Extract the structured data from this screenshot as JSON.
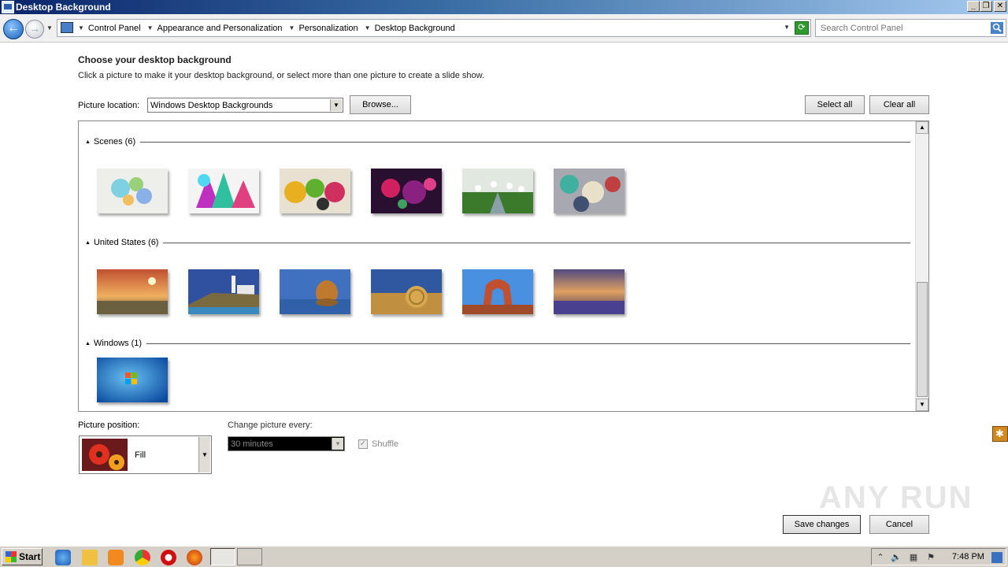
{
  "window": {
    "title": "Desktop Background"
  },
  "breadcrumbs": [
    "Control Panel",
    "Appearance and Personalization",
    "Personalization",
    "Desktop Background"
  ],
  "search": {
    "placeholder": "Search Control Panel"
  },
  "main": {
    "heading": "Choose your desktop background",
    "description": "Click a picture to make it your desktop background, or select more than one picture to create a slide show.",
    "location_label": "Picture location:",
    "location_value": "Windows Desktop Backgrounds",
    "browse_label": "Browse...",
    "select_all_label": "Select all",
    "clear_all_label": "Clear all"
  },
  "groups": [
    {
      "label": "Scenes (6)",
      "count": 6
    },
    {
      "label": "United States (6)",
      "count": 6
    },
    {
      "label": "Windows (1)",
      "count": 1
    }
  ],
  "bottom": {
    "position_label": "Picture position:",
    "position_value": "Fill",
    "interval_label": "Change picture every:",
    "interval_value": "30 minutes",
    "shuffle_label": "Shuffle",
    "shuffle_checked": true,
    "save_label": "Save changes",
    "cancel_label": "Cancel"
  },
  "watermark": "ANY RUN",
  "taskbar": {
    "start_label": "Start",
    "clock": "7:48 PM"
  },
  "icons": {
    "back": "back-arrow-icon",
    "forward": "forward-arrow-icon",
    "search": "magnifier-icon",
    "refresh": "refresh-icon"
  }
}
